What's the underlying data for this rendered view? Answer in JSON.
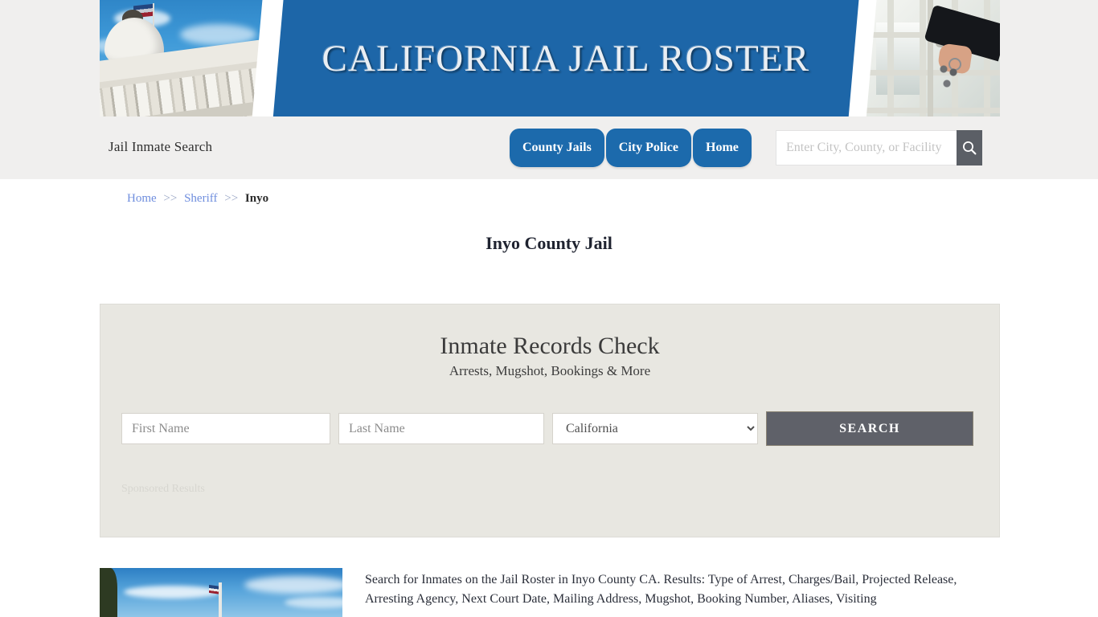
{
  "banner": {
    "title": "CALIFORNIA JAIL ROSTER",
    "left_image": "california-capitol-photo",
    "right_image": "jail-door-keys-photo"
  },
  "nav": {
    "site_title": "Jail Inmate Search",
    "tabs": [
      {
        "label": "County Jails"
      },
      {
        "label": "City Police"
      },
      {
        "label": "Home"
      }
    ],
    "search": {
      "placeholder": "Enter City, County, or Facility",
      "value": "",
      "button_icon": "search-icon"
    }
  },
  "breadcrumb": {
    "home": "Home",
    "sep1": ">>",
    "sheriff": "Sheriff",
    "sep2": ">>",
    "current": "Inyo"
  },
  "page_title": "Inyo County Jail",
  "panel": {
    "heading": "Inmate Records Check",
    "subheading": "Arrests, Mugshot, Bookings & More",
    "first_name_placeholder": "First Name",
    "first_name_value": "",
    "last_name_placeholder": "Last Name",
    "last_name_value": "",
    "state_selected": "California",
    "state_options": [
      "California"
    ],
    "search_button": "SEARCH",
    "sponsored_label": "Sponsored Results"
  },
  "content": {
    "thumbnail": "sky-flagpole-photo",
    "paragraph": "Search for Inmates on the Jail Roster in Inyo County CA. Results: Type of Arrest, Charges/Bail, Projected Release, Arresting Agency, Next Court Date, Mailing Address, Mugshot, Booking Number, Aliases, Visiting"
  },
  "colors": {
    "brand_blue": "#1d66a8",
    "nav_strip": "#f0efee",
    "panel_bg": "#e8e7e1",
    "search_button": "#5f6169",
    "link_blue": "#6f8ede"
  }
}
